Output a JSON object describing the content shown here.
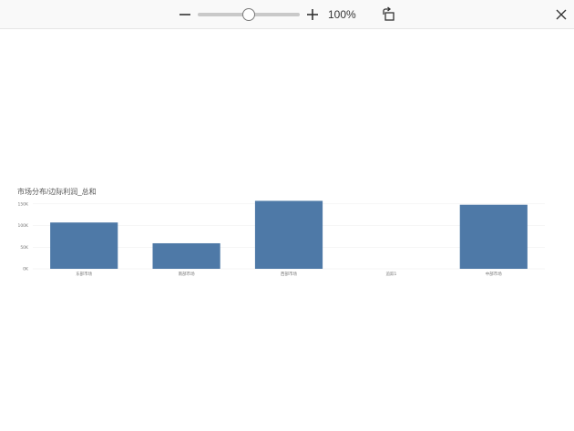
{
  "toolbar": {
    "zoom_out_icon": "minus-icon",
    "zoom_in_icon": "plus-icon",
    "rotate_icon": "rotate-icon",
    "close_icon": "close-icon",
    "zoom_level": "100%",
    "slider_fraction": 0.5
  },
  "colors": {
    "bar": "#4e79a7",
    "grid": "#eeeeee",
    "axis_text": "#777777"
  },
  "chart_data": {
    "type": "bar",
    "title": "市场分布/边际利润_总和",
    "categories": [
      "东部市场",
      "南部市场",
      "西部市场",
      "追踪1",
      "中部市场"
    ],
    "values": [
      107000,
      59000,
      157000,
      0,
      148000
    ],
    "yticks": [
      0,
      50000,
      100000,
      150000
    ],
    "ytick_labels": [
      "0K",
      "50K",
      "100K",
      "150K"
    ],
    "ylim": [
      0,
      160000
    ],
    "grid": true
  }
}
